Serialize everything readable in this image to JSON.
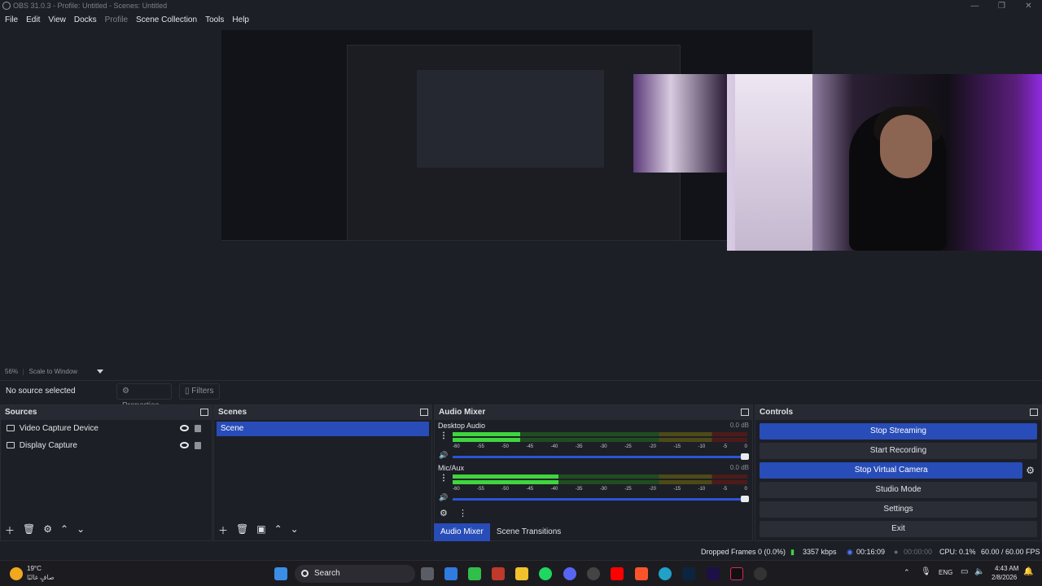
{
  "window": {
    "title": "OBS 31.0.3 - Profile: Untitled - Scenes: Untitled",
    "controls": [
      "—",
      "❐",
      "✕"
    ]
  },
  "menu": [
    "File",
    "Edit",
    "View",
    "Docks",
    "Profile",
    "Scene Collection",
    "Tools",
    "Help"
  ],
  "zoom": {
    "level": "56%",
    "mode": "Scale to Window"
  },
  "info": {
    "no_source": "No source selected",
    "properties": "Properties",
    "filters": "Filters"
  },
  "sources": {
    "title": "Sources",
    "items": [
      {
        "label": "Video Capture Device",
        "icon": "camera-icon"
      },
      {
        "label": "Display Capture",
        "icon": "monitor-icon"
      }
    ]
  },
  "scenes": {
    "title": "Scenes",
    "items": [
      "Scene"
    ]
  },
  "mixer": {
    "title": "Audio Mixer",
    "channels": [
      {
        "name": "Desktop Audio",
        "db": "0.0 dB",
        "level": 0.23
      },
      {
        "name": "Mic/Aux",
        "db": "0.0 dB",
        "level": 0.36
      }
    ],
    "ticks": [
      "-60",
      "-55",
      "-50",
      "-45",
      "-40",
      "-35",
      "-30",
      "-25",
      "-20",
      "-15",
      "-10",
      "-5",
      "0"
    ],
    "tabs": [
      "Audio Mixer",
      "Scene Transitions"
    ]
  },
  "controls": {
    "title": "Controls",
    "stop_streaming": "Stop Streaming",
    "start_recording": "Start Recording",
    "stop_virtual_camera": "Stop Virtual Camera",
    "studio_mode": "Studio Mode",
    "settings": "Settings",
    "exit": "Exit"
  },
  "status": {
    "dropped": "Dropped Frames 0 (0.0%)",
    "bitrate": "3357 kbps",
    "stream_time": "00:16:09",
    "rec_time": "00:00:00",
    "cpu": "CPU: 0.1%",
    "fps": "60.00 / 60.00 FPS"
  },
  "taskbar": {
    "weather_temp": "19°C",
    "weather_desc": "صافٍ غالبًا",
    "search": "Search",
    "lang": "ENG",
    "time": "4:43 AM",
    "date": "2/8/2026"
  }
}
